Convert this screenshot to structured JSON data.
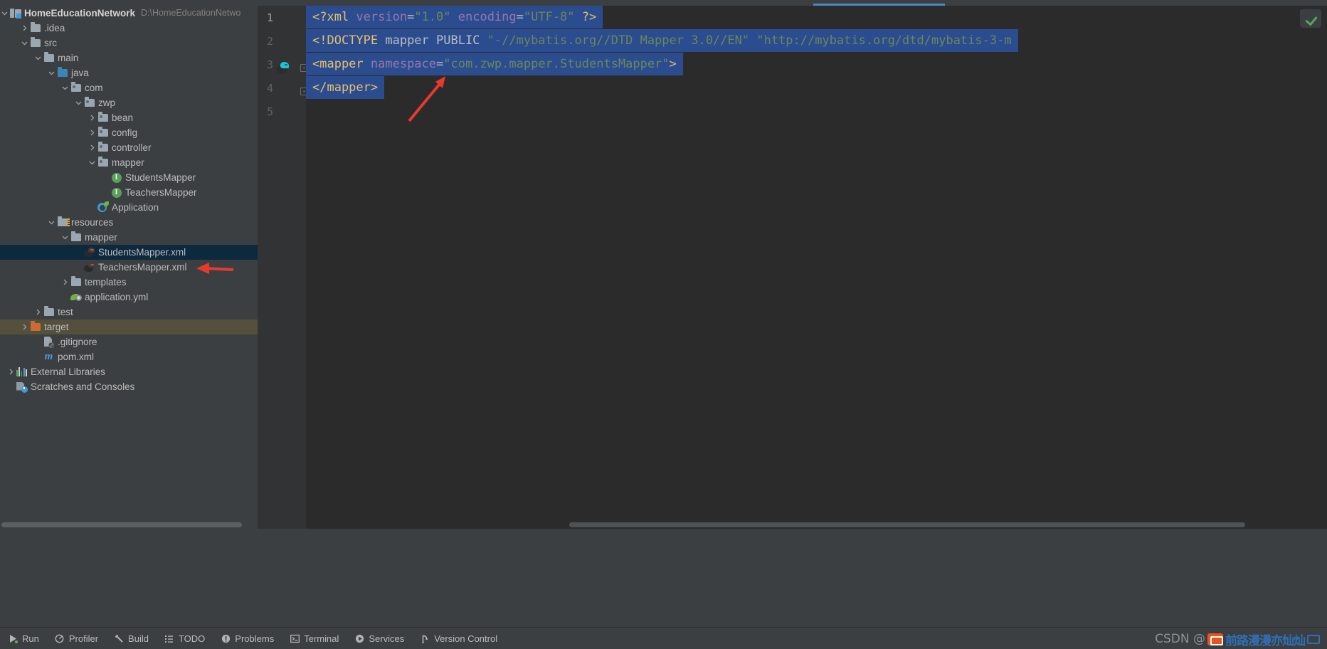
{
  "window": {
    "accent_blue": "#4a88c7",
    "bg": "#3c3f41",
    "editor_bg": "#2b2b2b",
    "selection_bg": "#2b4d8f"
  },
  "project_tree": {
    "root_label": "HomeEducationNetwork",
    "root_path": "D:\\HomeEducationNetwo",
    "items": [
      {
        "label": ".idea",
        "icon": "folder-icon",
        "depth": 1,
        "arrow": "collapsed"
      },
      {
        "label": "src",
        "icon": "folder-icon",
        "depth": 1,
        "arrow": "expanded"
      },
      {
        "label": "main",
        "icon": "folder-icon",
        "depth": 2,
        "arrow": "expanded"
      },
      {
        "label": "java",
        "icon": "source-folder-icon",
        "depth": 3,
        "arrow": "expanded"
      },
      {
        "label": "com",
        "icon": "package-icon",
        "depth": 4,
        "arrow": "expanded"
      },
      {
        "label": "zwp",
        "icon": "package-icon",
        "depth": 5,
        "arrow": "expanded"
      },
      {
        "label": "bean",
        "icon": "package-icon",
        "depth": 6,
        "arrow": "collapsed"
      },
      {
        "label": "config",
        "icon": "package-icon",
        "depth": 6,
        "arrow": "collapsed"
      },
      {
        "label": "controller",
        "icon": "package-icon",
        "depth": 6,
        "arrow": "collapsed"
      },
      {
        "label": "mapper",
        "icon": "package-icon",
        "depth": 6,
        "arrow": "expanded"
      },
      {
        "label": "StudentsMapper",
        "icon": "java-interface-icon",
        "depth": 7,
        "arrow": "none"
      },
      {
        "label": "TeachersMapper",
        "icon": "java-interface-icon",
        "depth": 7,
        "arrow": "none"
      },
      {
        "label": "Application",
        "icon": "spring-boot-icon",
        "depth": 6,
        "arrow": "none"
      },
      {
        "label": "resources",
        "icon": "resources-folder-icon",
        "depth": 3,
        "arrow": "expanded"
      },
      {
        "label": "mapper",
        "icon": "folder-icon",
        "depth": 4,
        "arrow": "expanded"
      },
      {
        "label": "StudentsMapper.xml",
        "icon": "mybatis-icon",
        "depth": 5,
        "arrow": "none",
        "state": "selected"
      },
      {
        "label": "TeachersMapper.xml",
        "icon": "mybatis-icon",
        "depth": 5,
        "arrow": "none"
      },
      {
        "label": "templates",
        "icon": "folder-icon",
        "depth": 4,
        "arrow": "collapsed"
      },
      {
        "label": "application.yml",
        "icon": "yaml-spring-icon",
        "depth": 4,
        "arrow": "none"
      },
      {
        "label": "test",
        "icon": "folder-icon",
        "depth": 2,
        "arrow": "collapsed"
      },
      {
        "label": "target",
        "icon": "excluded-folder-icon",
        "depth": 1,
        "arrow": "collapsed",
        "state": "excluded"
      },
      {
        "label": ".gitignore",
        "icon": "gitignore-icon",
        "depth": 2,
        "arrow": "none"
      },
      {
        "label": "pom.xml",
        "icon": "maven-icon",
        "depth": 2,
        "arrow": "none"
      },
      {
        "label": "External Libraries",
        "icon": "libraries-icon",
        "depth": 0,
        "arrow": "collapsed"
      },
      {
        "label": "Scratches and Consoles",
        "icon": "scratches-icon",
        "depth": 0,
        "arrow": "none"
      }
    ]
  },
  "editor": {
    "line_numbers": [
      "1",
      "2",
      "3",
      "4",
      "5"
    ],
    "lines": [
      {
        "number": "1",
        "text": "<?xml version=\"1.0\" encoding=\"UTF-8\" ?>",
        "tokens": [
          {
            "t": "<?xml",
            "c": "tag"
          },
          {
            "t": " version",
            "c": "attr"
          },
          {
            "t": "=",
            "c": "eq"
          },
          {
            "t": "\"1.0\"",
            "c": "str"
          },
          {
            "t": " encoding",
            "c": "attr"
          },
          {
            "t": "=",
            "c": "eq"
          },
          {
            "t": "\"UTF-8\"",
            "c": "str"
          },
          {
            "t": " ?>",
            "c": "tag"
          }
        ]
      },
      {
        "number": "2",
        "text": "<!DOCTYPE mapper PUBLIC \"-//mybatis.org//DTD Mapper 3.0//EN\" \"http://mybatis.org/dtd/mybatis-3-m",
        "tokens": [
          {
            "t": "<!DOCTYPE",
            "c": "tag"
          },
          {
            "t": " mapper PUBLIC ",
            "c": "name"
          },
          {
            "t": "\"-//mybatis.org//DTD Mapper 3.0//EN\" \"http://mybatis.org/dtd/mybatis-3-m",
            "c": "str"
          }
        ]
      },
      {
        "number": "3",
        "text": "<mapper namespace=\"com.zwp.mapper.StudentsMapper\">",
        "tokens": [
          {
            "t": "<mapper",
            "c": "tag"
          },
          {
            "t": " namespace",
            "c": "attr"
          },
          {
            "t": "=",
            "c": "eq"
          },
          {
            "t": "\"com.zwp.mapper.StudentsMapper\"",
            "c": "str"
          },
          {
            "t": ">",
            "c": "tag"
          }
        ]
      },
      {
        "number": "4",
        "text": "</mapper>",
        "tokens": [
          {
            "t": "</mapper>",
            "c": "tag"
          }
        ]
      }
    ],
    "fold_markers": [
      "-",
      "-"
    ],
    "gutter_icon": "mybatis-mapper-icon",
    "inspection_status": "check-icon"
  },
  "annotations": {
    "arrow_editor": {
      "label": "red-arrow-pointing-to-mapper-close-tag",
      "color": "#e8392d"
    },
    "arrow_tree": {
      "label": "red-arrow-pointing-to-teachers-mapper-xml",
      "color": "#e8392d"
    }
  },
  "bottom_bar": {
    "items": [
      {
        "label": "Run",
        "icon": "run-icon"
      },
      {
        "label": "Profiler",
        "icon": "profiler-icon"
      },
      {
        "label": "Build",
        "icon": "build-hammer-icon"
      },
      {
        "label": "TODO",
        "icon": "todo-list-icon"
      },
      {
        "label": "Problems",
        "icon": "problems-icon"
      },
      {
        "label": "Terminal",
        "icon": "terminal-icon"
      },
      {
        "label": "Services",
        "icon": "services-icon"
      },
      {
        "label": "Version Control",
        "icon": "version-control-icon"
      }
    ],
    "watermark": {
      "prefix": "CSDN @",
      "name": "前路漫漫亦灿灿"
    }
  }
}
